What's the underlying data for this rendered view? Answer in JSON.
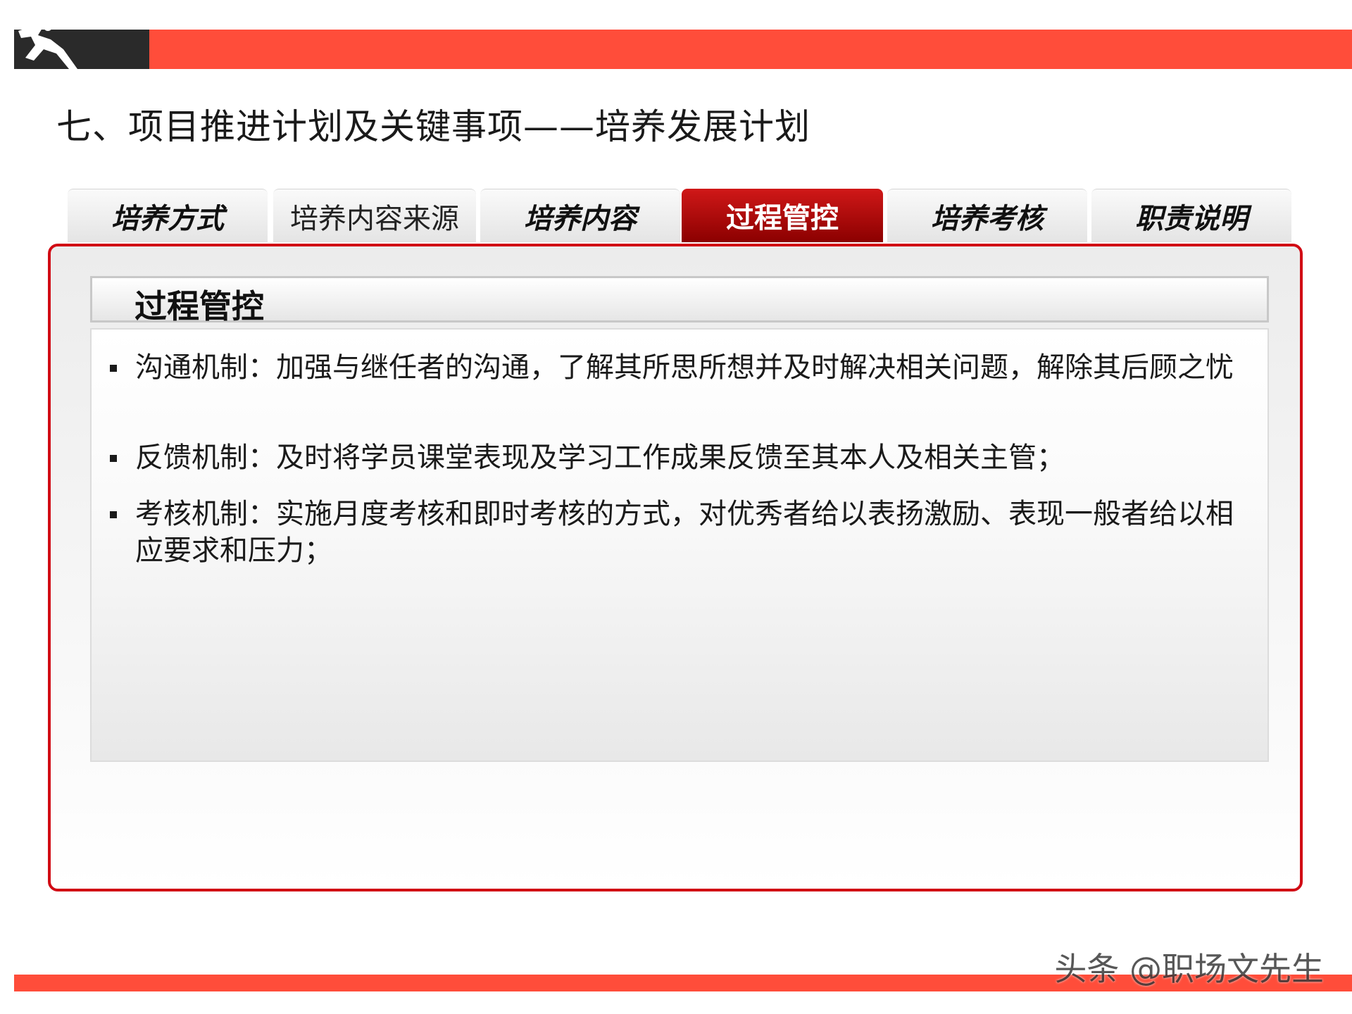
{
  "title": "七、项目推进计划及关键事项——培养发展计划",
  "tabs": [
    {
      "label": "培养方式",
      "active": false,
      "style": "bold-italic"
    },
    {
      "label": "培养内容来源",
      "active": false,
      "style": "plain"
    },
    {
      "label": "培养内容",
      "active": false,
      "style": "bold-italic"
    },
    {
      "label": "过程管控",
      "active": true,
      "style": "bold"
    },
    {
      "label": "培养考核",
      "active": false,
      "style": "bold-italic"
    },
    {
      "label": "职责说明",
      "active": false,
      "style": "bold-italic"
    }
  ],
  "section": {
    "heading": "过程管控",
    "bullets": [
      {
        "text": "沟通机制：加强与继任者的沟通，了解其所思所想并及时解决相关问题，解除其后顾之忧"
      },
      {
        "text": "反馈机制：及时将学员课堂表现及学习工作成果反馈至其本人及相关主管；"
      },
      {
        "text": "考核机制：实施月度考核和即时考核的方式，对优秀者给以表扬激励、表现一般者给以相应要求和压力；"
      }
    ]
  },
  "watermark": "头条 @职场文先生",
  "colors": {
    "accent_red": "#ff4d3a",
    "panel_border": "#d10a14",
    "active_tab": "#b00000",
    "dark_block": "#2a2a2a"
  },
  "icons": {
    "logo": "runner-silhouette-icon"
  }
}
